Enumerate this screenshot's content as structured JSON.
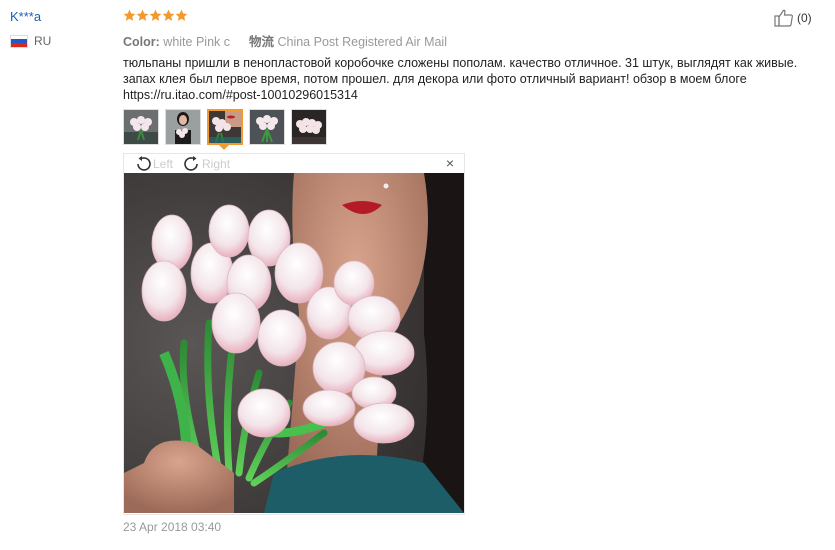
{
  "review": {
    "user": "K***a",
    "country": "RU",
    "rating": 5,
    "color_label": "Color:",
    "color_value": "white Pink c",
    "shipping_label": "物流",
    "shipping_value": "China Post Registered Air Mail",
    "helpful_count": "(0)",
    "text": "тюльпаны пришли в пенопластовой коробочке сложены пополам. качество отличное. 31 штук, выглядят как живые. запах клея был первое время, потом прошел. для декора или фото отличный вариант! обзор в моем блоге https://ru.itao.com/#post-10010296015314",
    "date": "23 Apr 2018 03:40"
  },
  "viewer": {
    "rotate_left": "Left",
    "rotate_right": "Right",
    "close": "×",
    "selected_index": 2
  },
  "colors": {
    "user_link": "#1a5fb4",
    "star": "#f29a2e",
    "selected_border": "#f29a2e"
  },
  "icons": [
    "star-icon",
    "thumbs-up-icon",
    "rotate-left-icon",
    "rotate-right-icon",
    "close-icon",
    "flag-ru-icon"
  ]
}
